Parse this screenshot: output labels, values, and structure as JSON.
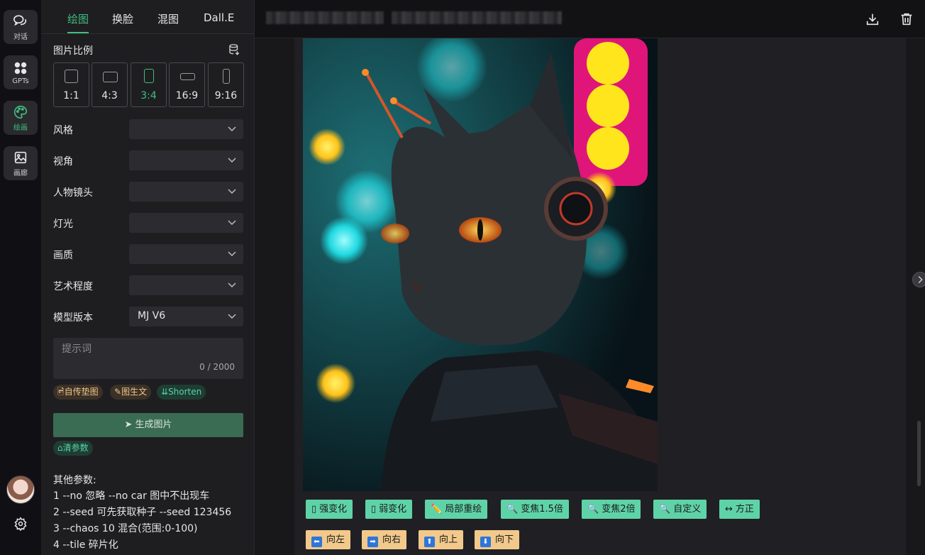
{
  "rail": {
    "items": [
      {
        "label": "对话",
        "icon": "chat-icon"
      },
      {
        "label": "GPTs",
        "icon": "grid-icon"
      },
      {
        "label": "绘画",
        "icon": "palette-icon"
      },
      {
        "label": "画廊",
        "icon": "gallery-icon"
      }
    ],
    "active_index": 2,
    "accent": "#3fbf7f"
  },
  "tabs": [
    "绘图",
    "换脸",
    "混图",
    "Dall.E"
  ],
  "active_tab": 0,
  "ratio": {
    "label": "图片比例",
    "options": [
      "1:1",
      "4:3",
      "3:4",
      "16:9",
      "9:16"
    ],
    "selected": "3:4"
  },
  "selects": [
    {
      "label": "风格",
      "value": ""
    },
    {
      "label": "视角",
      "value": ""
    },
    {
      "label": "人物镜头",
      "value": ""
    },
    {
      "label": "灯光",
      "value": ""
    },
    {
      "label": "画质",
      "value": ""
    },
    {
      "label": "艺术程度",
      "value": ""
    },
    {
      "label": "模型版本",
      "value": "MJ V6"
    }
  ],
  "prompt": {
    "placeholder": "提示词",
    "value": "",
    "counter": "0 / 2000"
  },
  "chips": [
    "自传垫图",
    "图生文",
    "Shorten"
  ],
  "generate_label": "生成图片",
  "clear_label": "清参数",
  "params": {
    "title": "其他参数:",
    "lines": [
      "1 --no 忽略 --no car 图中不出现车",
      "2 --seed 可先获取种子 --seed 123456",
      "3 --chaos 10 混合(范围:0-100)",
      "4 --tile 碎片化"
    ]
  },
  "actions_row1": [
    {
      "label": "强变化",
      "icon": "box-icon"
    },
    {
      "label": "弱变化",
      "icon": "box-icon"
    },
    {
      "label": "局部重绘",
      "icon": "pencil-icon"
    },
    {
      "label": "变焦1.5倍",
      "icon": "magnifier-icon"
    },
    {
      "label": "变焦2倍",
      "icon": "magnifier-icon"
    },
    {
      "label": "自定义",
      "icon": "magnifier-icon"
    },
    {
      "label": "方正",
      "icon": "arrows-icon"
    }
  ],
  "actions_row2": [
    {
      "label": "向左",
      "arrow": "⬅"
    },
    {
      "label": "向右",
      "arrow": "➡"
    },
    {
      "label": "向上",
      "arrow": "⬆"
    },
    {
      "label": "向下",
      "arrow": "⬇"
    }
  ],
  "colors": {
    "action_teal": "#5fd3a8",
    "action_tan": "#f2c98b",
    "generate_button": "#3a6b53"
  }
}
